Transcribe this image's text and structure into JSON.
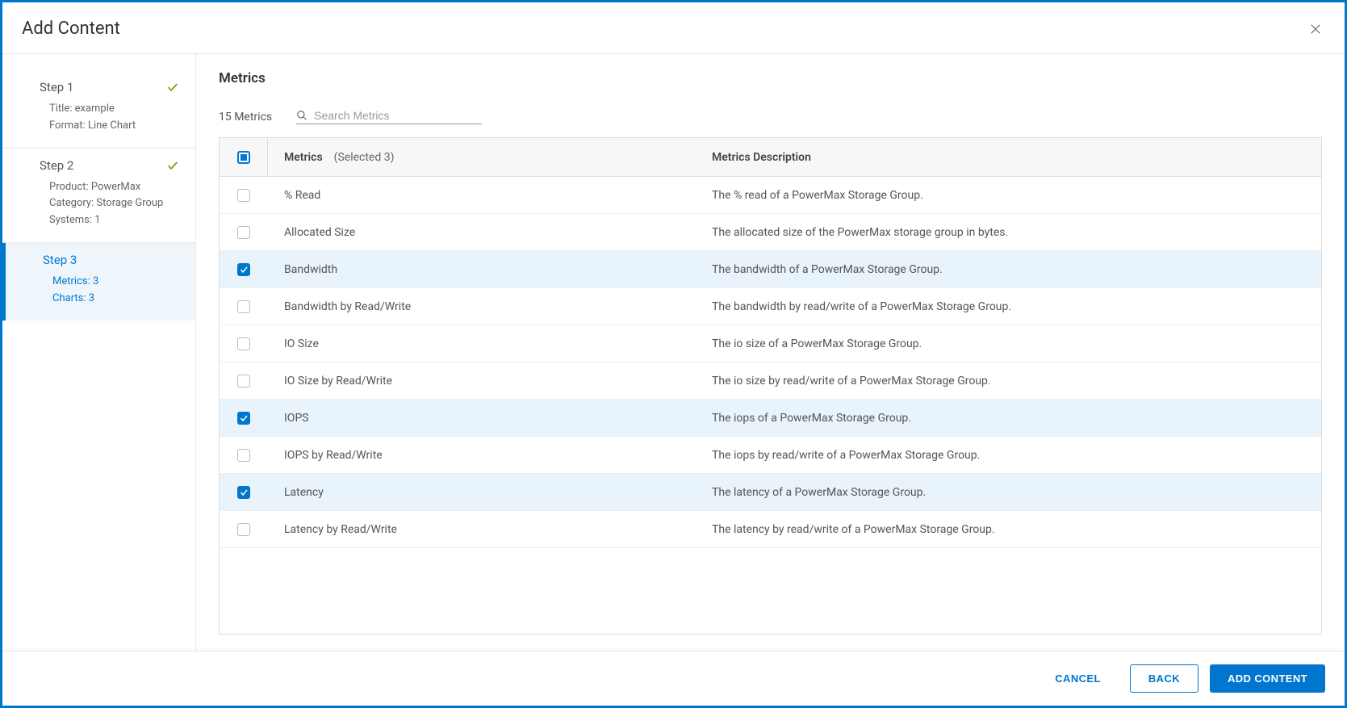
{
  "modal": {
    "title": "Add Content"
  },
  "sidebar": {
    "steps": [
      {
        "title": "Step 1",
        "completed": true,
        "details": [
          "Title: example",
          "Format: Line Chart"
        ]
      },
      {
        "title": "Step 2",
        "completed": true,
        "details": [
          "Product: PowerMax",
          "Category: Storage Group",
          "Systems: 1"
        ]
      },
      {
        "title": "Step 3",
        "completed": false,
        "active": true,
        "details": [
          "Metrics: 3",
          "Charts: 3"
        ]
      }
    ]
  },
  "main": {
    "title": "Metrics",
    "count_label": "15 Metrics",
    "search_placeholder": "Search Metrics",
    "table": {
      "header_metric": "Metrics",
      "header_selected": "(Selected 3)",
      "header_desc": "Metrics Description",
      "rows": [
        {
          "selected": false,
          "name": "% Read",
          "desc": "The % read of a PowerMax Storage Group."
        },
        {
          "selected": false,
          "name": "Allocated Size",
          "desc": "The allocated size of the PowerMax storage group in bytes."
        },
        {
          "selected": true,
          "name": "Bandwidth",
          "desc": "The bandwidth of a PowerMax Storage Group."
        },
        {
          "selected": false,
          "name": "Bandwidth by Read/Write",
          "desc": "The bandwidth by read/write of a PowerMax Storage Group."
        },
        {
          "selected": false,
          "name": "IO Size",
          "desc": "The io size of a PowerMax Storage Group."
        },
        {
          "selected": false,
          "name": "IO Size by Read/Write",
          "desc": "The io size by read/write of a PowerMax Storage Group."
        },
        {
          "selected": true,
          "name": "IOPS",
          "desc": "The iops of a PowerMax Storage Group."
        },
        {
          "selected": false,
          "name": "IOPS by Read/Write",
          "desc": "The iops by read/write of a PowerMax Storage Group."
        },
        {
          "selected": true,
          "name": "Latency",
          "desc": "The latency of a PowerMax Storage Group."
        },
        {
          "selected": false,
          "name": "Latency by Read/Write",
          "desc": "The latency by read/write of a PowerMax Storage Group."
        }
      ]
    }
  },
  "footer": {
    "cancel": "CANCEL",
    "back": "BACK",
    "add": "ADD CONTENT"
  }
}
